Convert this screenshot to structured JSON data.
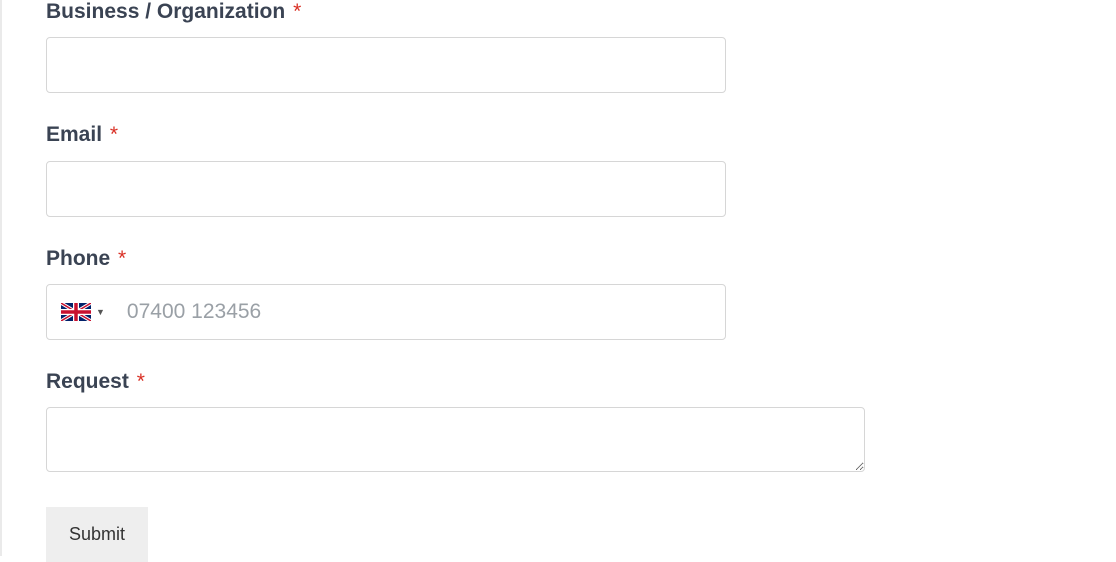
{
  "form": {
    "business": {
      "label": "Business / Organization",
      "required": "*",
      "value": ""
    },
    "email": {
      "label": "Email",
      "required": "*",
      "value": ""
    },
    "phone": {
      "label": "Phone",
      "required": "*",
      "placeholder": "07400 123456",
      "value": "",
      "country": "GB"
    },
    "request": {
      "label": "Request",
      "required": "*",
      "value": ""
    },
    "submit_label": "Submit"
  }
}
